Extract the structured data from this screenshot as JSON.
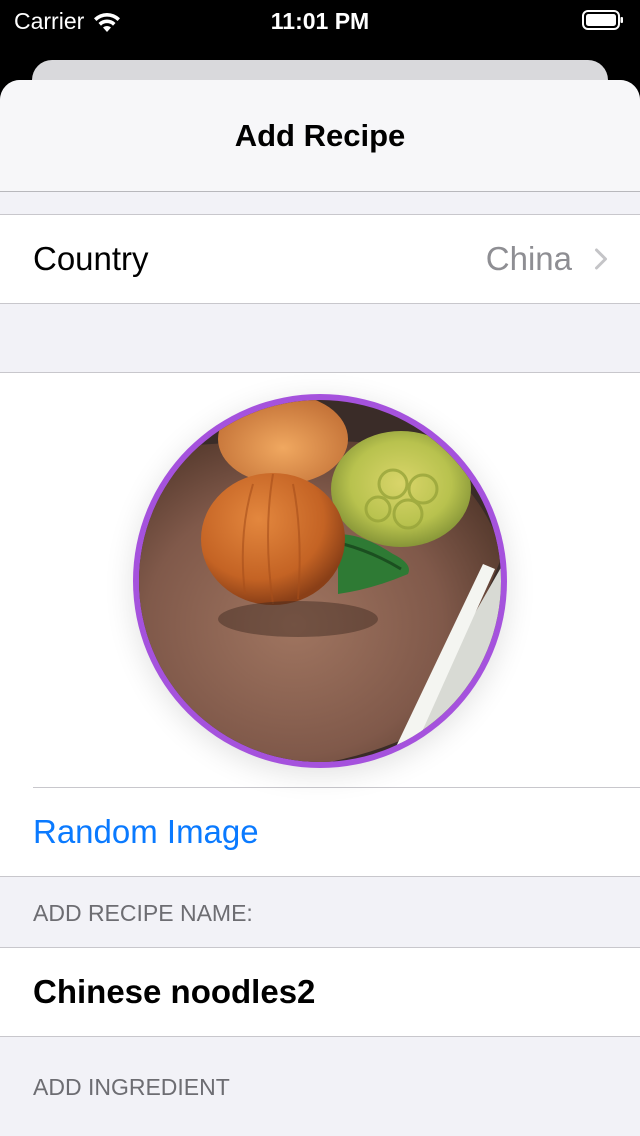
{
  "status_bar": {
    "carrier": "Carrier",
    "time": "11:01 PM",
    "icons": [
      "wifi-icon",
      "battery-icon"
    ]
  },
  "nav": {
    "title": "Add Recipe"
  },
  "country_row": {
    "label": "Country",
    "value": "China",
    "icon": "chevron-right-icon"
  },
  "image_section": {
    "border_color": "#a552dd",
    "random_image_label": "Random Image"
  },
  "recipe_name_section": {
    "header": "ADD RECIPE NAME:",
    "value": "Chinese noodles2"
  },
  "ingredient_section": {
    "header": "ADD INGREDIENT"
  },
  "colors": {
    "accent": "#0a7aff",
    "secondary_text": "#8e8e93",
    "grouped_background": "#f2f2f7"
  }
}
